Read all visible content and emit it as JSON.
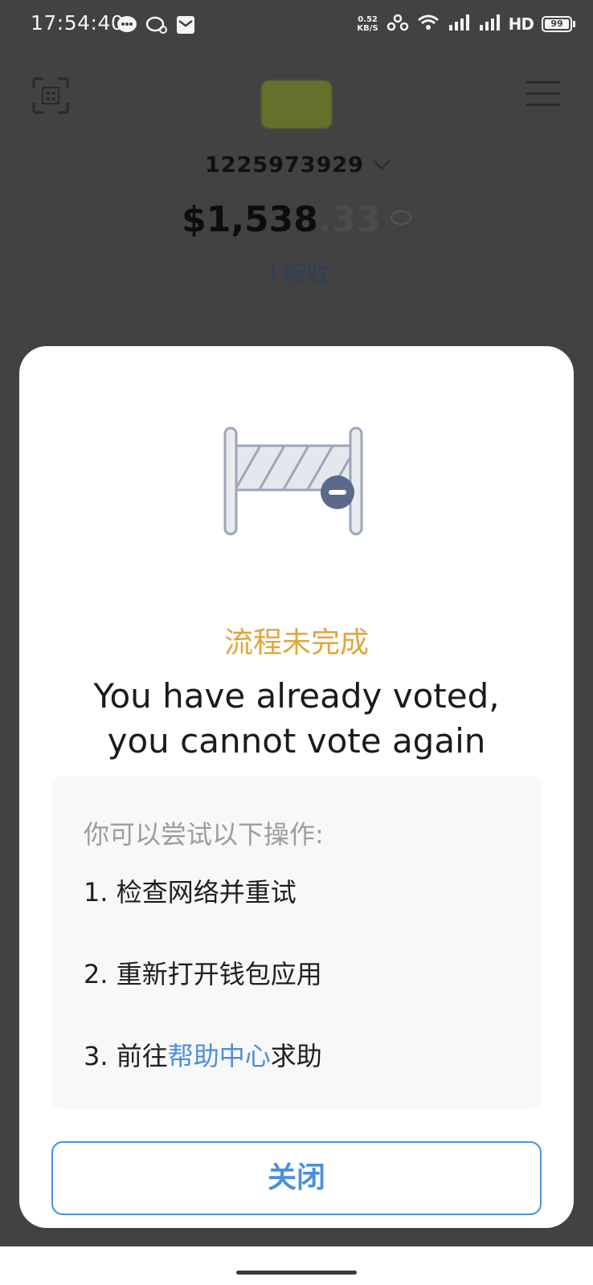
{
  "status_bar": {
    "time": "17:54:40",
    "speed_value": "0.52",
    "speed_unit": "KB/S",
    "network_label": "HD",
    "battery": "99"
  },
  "header": {
    "account": "1225973929",
    "balance_main": "$1,538",
    "balance_decimal": ".33",
    "receive_label": "↓接收"
  },
  "dialog": {
    "subtitle": "流程未完成",
    "title_line1": "You have already voted,",
    "title_line2": "you cannot vote again",
    "tips_heading": "你可以尝试以下操作:",
    "tip1": "1. 检查网络并重试",
    "tip2": "2. 重新打开钱包应用",
    "tip3_prefix": "3. 前往",
    "tip3_link": "帮助中心",
    "tip3_suffix": "求助",
    "close_label": "关闭"
  },
  "colors": {
    "accent": "#4a90d9",
    "warning": "#e0a53d",
    "overlay": "#424242"
  },
  "icons": [
    "scan-icon",
    "menu-icon",
    "barrier-icon",
    "eye-icon",
    "chevron-down-icon",
    "message-icon",
    "chat-icon",
    "mail-icon",
    "wifi-icon",
    "signal-icon",
    "battery-icon"
  ]
}
